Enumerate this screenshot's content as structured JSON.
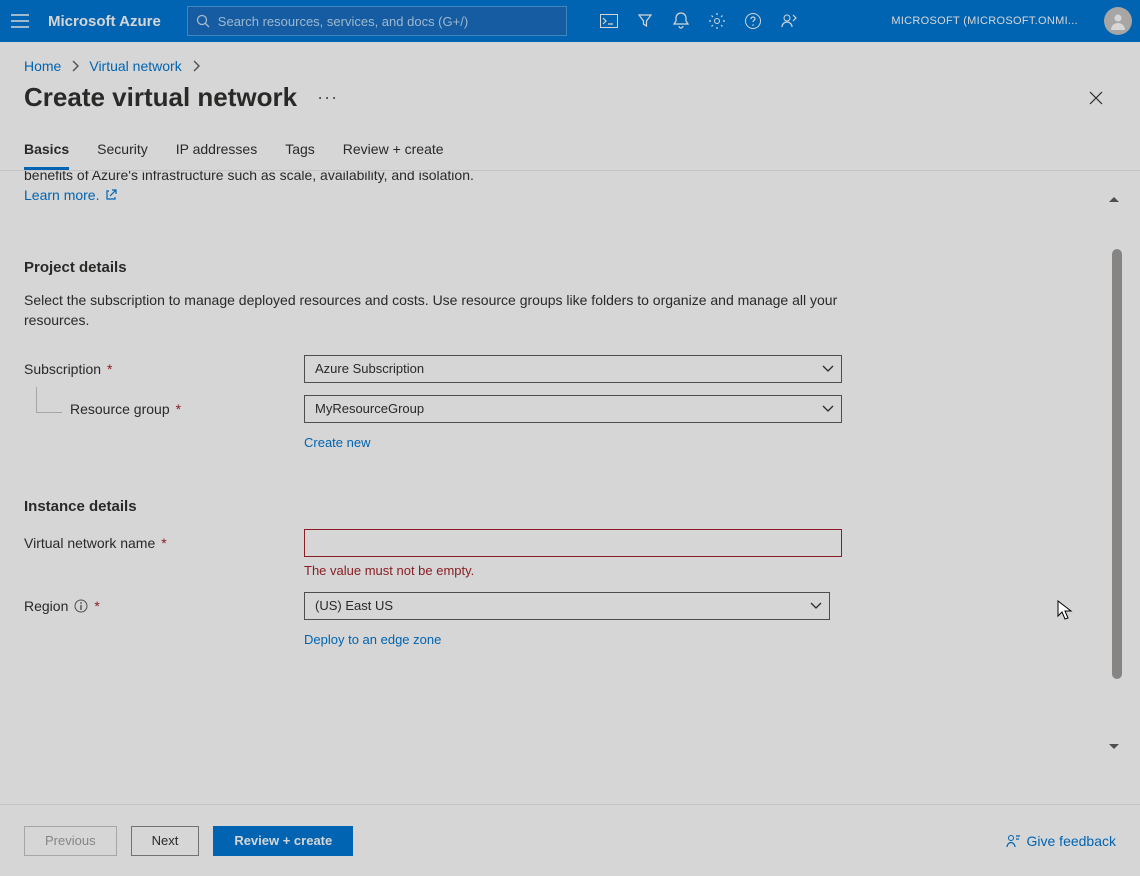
{
  "topbar": {
    "brand": "Microsoft Azure",
    "search_placeholder": "Search resources, services, and docs (G+/)",
    "tenant": "MICROSOFT (MICROSOFT.ONMI..."
  },
  "breadcrumb": {
    "home": "Home",
    "vnet": "Virtual network"
  },
  "page": {
    "title": "Create virtual network"
  },
  "tabs": {
    "basics": "Basics",
    "security": "Security",
    "ip": "IP addresses",
    "tags": "Tags",
    "review": "Review + create"
  },
  "intro": {
    "partial": "benefits of Azure's infrastructure such as scale, availability, and isolation.",
    "learn_more": "Learn more."
  },
  "project": {
    "heading": "Project details",
    "desc": "Select the subscription to manage deployed resources and costs. Use resource groups like folders to organize and manage all your resources.",
    "subscription_label": "Subscription",
    "subscription_value": "Azure Subscription",
    "rg_label": "Resource group",
    "rg_value": "MyResourceGroup",
    "create_new": "Create new"
  },
  "instance": {
    "heading": "Instance details",
    "vnet_label": "Virtual network name",
    "vnet_value": "",
    "vnet_error": "The value must not be empty.",
    "region_label": "Region",
    "region_value": "(US) East US",
    "edge_link": "Deploy to an edge zone"
  },
  "footer": {
    "prev": "Previous",
    "next": "Next",
    "review": "Review + create",
    "feedback": "Give feedback"
  }
}
